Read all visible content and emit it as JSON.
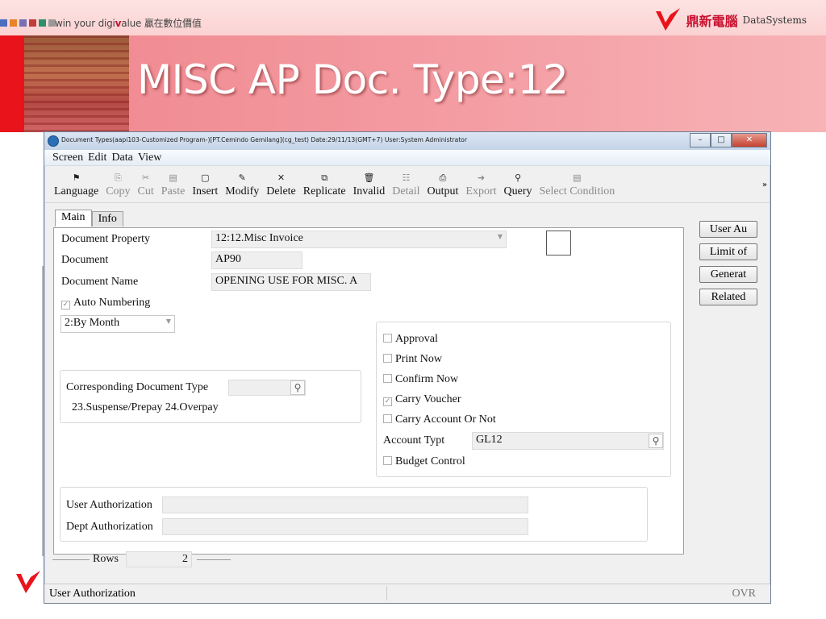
{
  "slide": {
    "tagline_prefix": "win your digi",
    "tagline_v": "v",
    "tagline_suffix": "alue",
    "tagline_cn": "贏在數位價值",
    "brand_cn": "鼎新電腦",
    "brand_en": "DataSystems",
    "title": "MISC AP Doc. Type:12",
    "square_colors": [
      "#4a6fc1",
      "#e8842a",
      "#7a6fb3",
      "#c43b3b",
      "#2f8f6b",
      "#999999"
    ],
    "accent": "#e8131b"
  },
  "window": {
    "title": "Document Types(aapi103-Customized Program-)[PT.Cemindo Gemilang](cg_test)  Date:29/11/13(GMT+7)  User:System Administrator",
    "btn_min": "–",
    "btn_max": "□",
    "btn_close": "✕"
  },
  "menu": [
    "Screen",
    "Edit",
    "Data",
    "View"
  ],
  "toolbar": {
    "items": [
      {
        "label": "Language",
        "icon": "⚑",
        "enabled": true
      },
      {
        "label": "Copy",
        "icon": "⎘",
        "enabled": false
      },
      {
        "label": "Cut",
        "icon": "✂",
        "enabled": false
      },
      {
        "label": "Paste",
        "icon": "▤",
        "enabled": false
      },
      {
        "label": "Insert",
        "icon": "▢",
        "enabled": true
      },
      {
        "label": "Modify",
        "icon": "✎",
        "enabled": true
      },
      {
        "label": "Delete",
        "icon": "✕",
        "enabled": true
      },
      {
        "label": "Replicate",
        "icon": "⧉",
        "enabled": true
      },
      {
        "label": "Invalid",
        "icon": "🗑",
        "enabled": true
      },
      {
        "label": "Detail",
        "icon": "☷",
        "enabled": false
      },
      {
        "label": "Output",
        "icon": "⎙",
        "enabled": true
      },
      {
        "label": "Export",
        "icon": "➜",
        "enabled": false
      },
      {
        "label": "Query",
        "icon": "⚲",
        "enabled": true
      },
      {
        "label": "Select Condition",
        "icon": "▤",
        "enabled": false
      }
    ],
    "more": "»"
  },
  "tabs": {
    "main": "Main",
    "info": "Info"
  },
  "form": {
    "document_property_label": "Document Property",
    "document_property_value": "12:12.Misc Invoice",
    "document_label": "Document",
    "document_value": "AP90",
    "document_name_label": "Document Name",
    "document_name_value": "OPENING USE FOR MISC. A",
    "auto_numbering_label": "Auto Numbering",
    "numbering_value": "2:By Month",
    "corresponding_label": "Corresponding Document Type",
    "corresponding_value": "",
    "corresponding_hint": "23.Suspense/Prepay 24.Overpay",
    "approval_label": "Approval",
    "print_now_label": "Print Now",
    "confirm_now_label": "Confirm Now",
    "carry_voucher_label": "Carry Voucher",
    "carry_account_label": "Carry Account Or Not",
    "account_type_label": "Account Typt",
    "account_type_value": "GL12",
    "budget_control_label": "Budget Control",
    "user_auth_label": "User Authorization",
    "user_auth_value": "",
    "dept_auth_label": "Dept Authorization",
    "dept_auth_value": "",
    "checkmark": "✓"
  },
  "side_buttons": [
    "User Au",
    "Limit of",
    "Generat",
    "Related"
  ],
  "rows": {
    "label": "Rows",
    "value": "2"
  },
  "status": {
    "text": "User Authorization",
    "mode": "OVR"
  }
}
